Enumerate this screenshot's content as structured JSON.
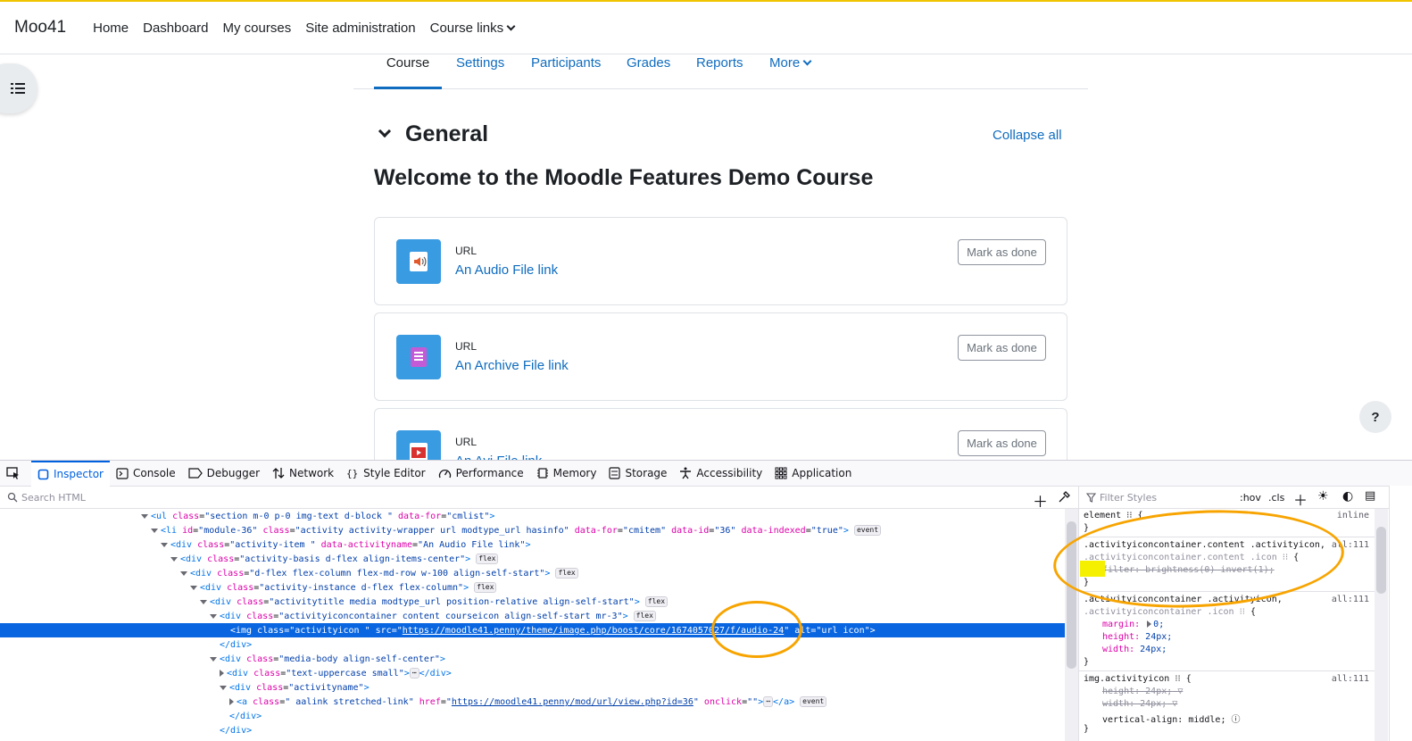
{
  "navbar": {
    "brand": "Moo41",
    "items": [
      "Home",
      "Dashboard",
      "My courses",
      "Site administration",
      "Course links"
    ]
  },
  "course_nav": {
    "tabs": [
      "Course",
      "Settings",
      "Participants",
      "Grades",
      "Reports",
      "More"
    ],
    "active": "Course"
  },
  "section": {
    "title": "General",
    "collapse_label": "Collapse all",
    "welcome": "Welcome to the Moodle Features Demo Course"
  },
  "activities": [
    {
      "type": "URL",
      "name": "An Audio File link",
      "button": "Mark as done",
      "icon": "audio-icon"
    },
    {
      "type": "URL",
      "name": "An Archive File link",
      "button": "Mark as done",
      "icon": "archive-icon"
    },
    {
      "type": "URL",
      "name": "An Avi File link",
      "button": "Mark as done",
      "icon": "video-icon"
    }
  ],
  "help": "?",
  "devtools": {
    "tabs": [
      "Inspector",
      "Console",
      "Debugger",
      "Network",
      "Style Editor",
      "Performance",
      "Memory",
      "Storage",
      "Accessibility",
      "Application"
    ],
    "active_tab": "Inspector",
    "search_placeholder": "Search HTML",
    "filter_placeholder": "Filter Styles",
    "pseudo_toggle": ":hov",
    "cls_toggle": ".cls",
    "markup": {
      "l1": {
        "tag": "ul",
        "class": "section m-0 p-0 img-text d-block ",
        "data_for": "cmlist"
      },
      "l2": {
        "id": "module-36",
        "class": "activity activity-wrapper url modtype_url hasinfo",
        "data_for": "cmitem",
        "data_id": "36",
        "data_indexed": "true",
        "badge": "event"
      },
      "l3": {
        "class": "activity-item ",
        "data_activityname": "An Audio File link"
      },
      "l4": {
        "class": "activity-basis d-flex align-items-center",
        "badge": "flex"
      },
      "l5": {
        "class": "d-flex flex-column flex-md-row w-100 align-self-start",
        "badge": "flex"
      },
      "l6": {
        "class": "activity-instance d-flex flex-column",
        "badge": "flex"
      },
      "l7": {
        "class": "activitytitle media modtype_url position-relative align-self-start",
        "badge": "flex"
      },
      "l8": {
        "class": "activityiconcontainer content courseicon align-self-start mr-3",
        "badge": "flex"
      },
      "l9": {
        "class": "activityicon ",
        "src": "https://moodle41.penny/theme/image.php/boost/core/1674057027/f/audio-24",
        "alt": "url icon"
      },
      "l11": {
        "class": "media-body align-self-center"
      },
      "l12": {
        "class": "text-uppercase small"
      },
      "l13": {
        "class": "activityname"
      },
      "l14": {
        "class": " aalink stretched-link",
        "href": "https://moodle41.penny/mod/url/view.php?id=36",
        "onclick": "",
        "badge": "event"
      }
    },
    "rules": {
      "element_selector": "element",
      "element_source": "inline",
      "r1_selector_a": ".activityiconcontainer.content .activityicon,",
      "r1_selector_b": ".activityiconcontainer.content .icon",
      "r1_source": "all:111",
      "r1_decl": "filter: brightness(0) invert(1);",
      "r2_selector_a": ".activityiconcontainer .activityicon,",
      "r2_selector_b": ".activityiconcontainer .icon",
      "r2_source": "all:111",
      "r2_margin": "margin: ",
      "r2_margin_val": "0;",
      "r2_height": "height: ",
      "r2_height_val": "24px;",
      "r2_width": "width: ",
      "r2_width_val": "24px;",
      "r3_selector": "img.activityicon",
      "r3_source": "all:111",
      "r3_height": "height: 24px;",
      "r3_width": "width: 24px;",
      "r3_valign": "vertical-align: ",
      "r3_valign_val": "middle;"
    }
  }
}
